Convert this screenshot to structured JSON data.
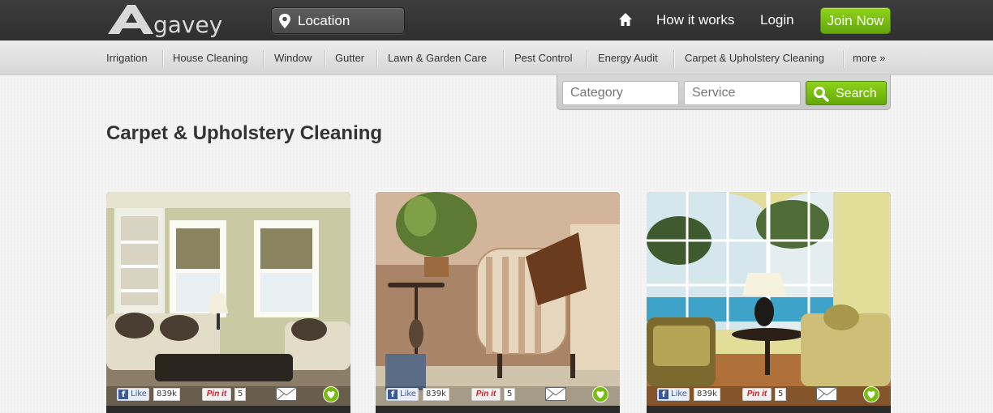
{
  "header": {
    "logo_text": "gavey",
    "location_placeholder": "Location",
    "nav": {
      "how_it_works": "How it works",
      "login": "Login",
      "join": "Join Now"
    }
  },
  "categories": [
    "Irrigation",
    "House Cleaning",
    "Window",
    "Gutter",
    "Lawn & Garden Care",
    "Pest Control",
    "Energy Audit",
    "Carpet & Upholstery Cleaning",
    "more »"
  ],
  "search": {
    "category_placeholder": "Category",
    "service_placeholder": "Service",
    "button": "Search"
  },
  "page_title": "Carpet & Upholstery Cleaning",
  "cards": [
    {
      "like": "Like",
      "like_count": "839k",
      "pin": "Pin it",
      "pin_count": "5"
    },
    {
      "like": "Like",
      "like_count": "839k",
      "pin": "Pin it",
      "pin_count": "5"
    },
    {
      "like": "Like",
      "like_count": "839k",
      "pin": "Pin it",
      "pin_count": "5"
    }
  ],
  "colors": {
    "accent_green": "#76bd0f",
    "topbar": "#333333",
    "facebook": "#3b5998",
    "pinterest": "#cb2027"
  }
}
